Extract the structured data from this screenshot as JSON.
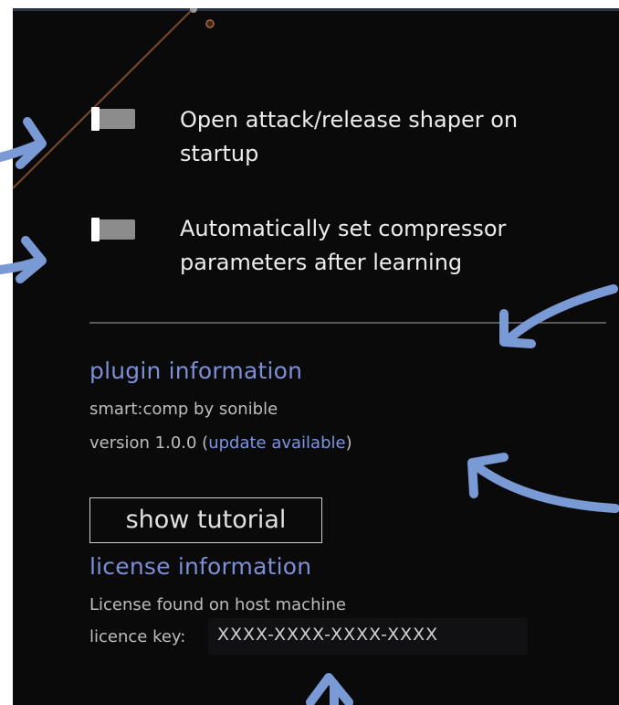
{
  "options": [
    {
      "label_line1": "Open attack/release shaper on",
      "label_line2": "startup",
      "enabled": false
    },
    {
      "label_line1": "Automatically set compressor",
      "label_line2": "parameters after learning",
      "enabled": false
    }
  ],
  "plugin_info": {
    "title": "plugin information",
    "product": "smart:comp by sonible",
    "version_prefix": "version 1.0.0 (",
    "update_link": "update available",
    "version_suffix": ")"
  },
  "tutorial": {
    "button_label": "show tutorial"
  },
  "license_info": {
    "title": "license information",
    "status": "License found on host machine",
    "key_label": "licence key:",
    "key_value": "XXXX-XXXX-XXXX-XXXX"
  },
  "colors": {
    "background": "#0a0a0b",
    "accent": "#7c8ed4",
    "annotation_arrow": "#7a9ad6",
    "curve": "#7a4a2a"
  }
}
